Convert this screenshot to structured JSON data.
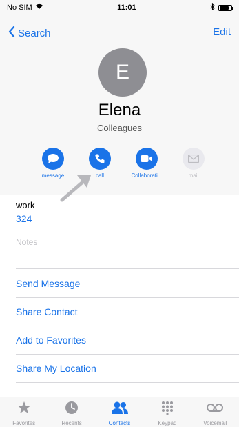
{
  "status": {
    "carrier": "No SIM",
    "time": "11:01",
    "battery_level": 0.8
  },
  "nav": {
    "back_label": "Search",
    "edit_label": "Edit"
  },
  "contact": {
    "initial": "E",
    "name": "Elena",
    "group": "Colleagues"
  },
  "actions": [
    {
      "label": "message",
      "icon": "message-icon",
      "enabled": true
    },
    {
      "label": "call",
      "icon": "phone-icon",
      "enabled": true
    },
    {
      "label": "Collaborati...",
      "icon": "video-icon",
      "enabled": true
    },
    {
      "label": "mail",
      "icon": "mail-icon",
      "enabled": false
    }
  ],
  "phone": {
    "label": "work",
    "number": "324"
  },
  "notes_placeholder": "Notes",
  "links": [
    "Send Message",
    "Share Contact",
    "Add to Favorites",
    "Share My Location"
  ],
  "tabs": [
    {
      "label": "Favorites",
      "icon": "star-icon",
      "active": false
    },
    {
      "label": "Recents",
      "icon": "clock-icon",
      "active": false
    },
    {
      "label": "Contacts",
      "icon": "contacts-icon",
      "active": true
    },
    {
      "label": "Keypad",
      "icon": "keypad-icon",
      "active": false
    },
    {
      "label": "Voicemail",
      "icon": "voicemail-icon",
      "active": false
    }
  ],
  "colors": {
    "accent": "#1a73e8",
    "avatar": "#8e8e93",
    "header_bg": "#f7f7f7"
  }
}
